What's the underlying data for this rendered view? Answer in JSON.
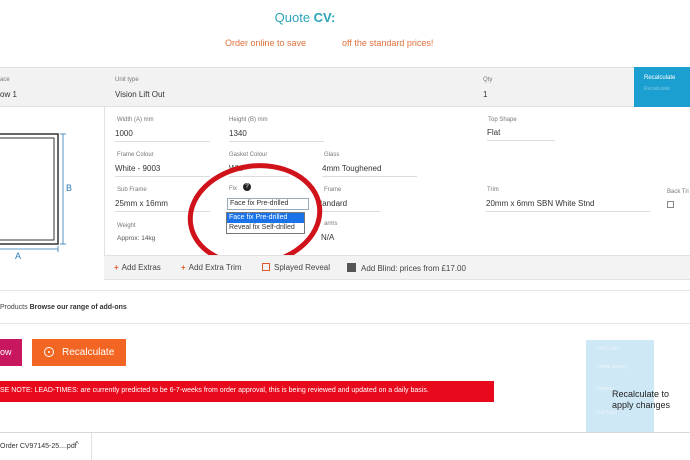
{
  "header": {
    "title_prefix": "Quote ",
    "title_bold": "CV:",
    "promo_part1": "Order online to save",
    "promo_part2": "off the standard prices!"
  },
  "top_row": {
    "ref_label": "ace",
    "ref_value": "ow 1",
    "unit_type_label": "Unit type",
    "unit_type_value": "Vision Lift Out",
    "qty_label": "Qty",
    "qty_value": "1",
    "recalc_label": "Recalculate",
    "recalc_ghost": "Recalculate"
  },
  "drawing": {
    "label_a": "A",
    "label_b": "B"
  },
  "fields": {
    "width_label": "Width (A) mm",
    "width_value": "1000",
    "height_label": "Height (B) mm",
    "height_value": "1340",
    "top_shape_label": "Top Shape",
    "top_shape_value": "Flat",
    "frame_colour_label": "Frame Colour",
    "frame_colour_value": "White - 9003",
    "gasket_colour_label": "Gasket Colour",
    "gasket_colour_value": "Whi",
    "glass_label": "Glass",
    "glass_value": "4mm Toughened",
    "sub_frame_label": "Sub Frame",
    "sub_frame_value": "25mm x 16mm",
    "fix_label": "Fix",
    "fix_help_icon": "?",
    "fix_value": "Face fix Pre-drilled",
    "frame_label": "Frame",
    "frame_value": "tandard",
    "trim_label": "Trim",
    "trim_value": "20mm x 6mm SBN White Stnd",
    "back_trim_label": "Back Tri",
    "weight_label": "Weight",
    "weight_value": "Approx: 14kg",
    "arms_label": "arms",
    "arms_value": "N/A"
  },
  "fix_dropdown": {
    "options": [
      "Face fix Pre-drilled",
      "Reveal fix Self-drilled"
    ],
    "selected_index": 0
  },
  "annotation": {
    "circle_color": "#d0121b"
  },
  "toolbar": {
    "add_extras": "Add Extras",
    "add_extra_trim": "Add Extra Trim",
    "splayed_reveal": "Splayed Reveal",
    "add_blind": "Add Blind: prices from £17.00"
  },
  "products": {
    "prefix": "Products",
    "link": "Browse our range of add-ons"
  },
  "buttons": {
    "pink_label": "ow",
    "recalculate_label": "Recalculate"
  },
  "notice": {
    "text": "SE NOTE: LEAD-TIMES: are currently predicted to be 6-7-weeks from order approval, this is being reviewed and updated on a daily basis."
  },
  "side_panel": {
    "ghost_lines": [
      "Unit Costs",
      "Online Saving",
      "Delivery",
      "Sub Total"
    ],
    "note": "Recalculate to apply changes"
  },
  "downloads": {
    "file_name": "Order CV97145-25....pdf",
    "chevron": "^"
  },
  "colors": {
    "accent_teal": "#2aa5b8",
    "promo_orange": "#e0703a",
    "recalc_blue": "#1b9fd0",
    "button_orange": "#f26522",
    "button_pink": "#c8175f",
    "notice_red": "#e8091c"
  }
}
